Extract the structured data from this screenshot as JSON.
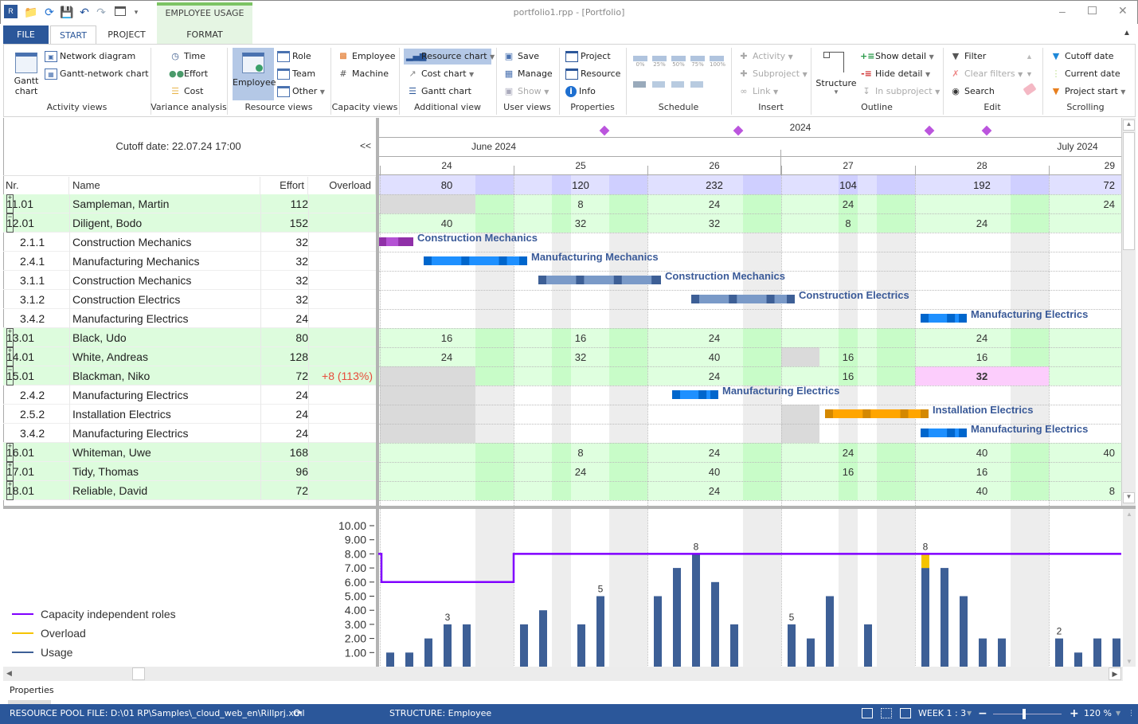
{
  "window": {
    "title": "portfolio1.rpp - [Portfolio]",
    "context_tab_group": "EMPLOYEE USAGE",
    "quick_access": [
      "app-logo-icon",
      "open-folder-icon",
      "refresh-icon",
      "save-icon",
      "undo-icon",
      "redo-icon",
      "window-layout-icon",
      "customize-dropdown-icon"
    ]
  },
  "tabs": [
    {
      "label": "FILE",
      "active": false
    },
    {
      "label": "START",
      "active": true
    },
    {
      "label": "PROJECT",
      "active": false
    },
    {
      "label": "FORMAT",
      "active": false
    }
  ],
  "ribbon": {
    "activity_views": {
      "label": "Activity views",
      "gantt": "Gantt\nchart",
      "gantt_l1": "Gantt",
      "gantt_l2": "chart",
      "network": "Network diagram",
      "gantt_network": "Gantt-network chart"
    },
    "variance": {
      "label": "Variance analysis",
      "time": "Time",
      "effort": "Effort",
      "cost": "Cost"
    },
    "resource_views": {
      "label": "Resource views",
      "employee": "Employee",
      "role": "Role",
      "team": "Team",
      "other": "Other"
    },
    "capacity_views": {
      "label": "Capacity views",
      "employee": "Employee",
      "machine": "Machine"
    },
    "additional_view": {
      "label": "Additional view",
      "resource_chart": "Resource chart",
      "cost_chart": "Cost chart",
      "gantt_chart": "Gantt chart"
    },
    "user_views": {
      "label": "User views",
      "save": "Save",
      "manage": "Manage",
      "show": "Show"
    },
    "properties": {
      "label": "Properties",
      "project": "Project",
      "resource": "Resource",
      "info": "Info"
    },
    "schedule": {
      "label": "Schedule",
      "progress": [
        "0%",
        "25%",
        "50%",
        "75%",
        "100%"
      ]
    },
    "insert": {
      "label": "Insert",
      "activity": "Activity",
      "subproject": "Subproject",
      "link": "Link"
    },
    "outline": {
      "label": "Outline",
      "structure": "Structure",
      "show_detail": "Show detail",
      "hide_detail": "Hide detail",
      "in_subproject": "In subproject"
    },
    "edit": {
      "label": "Edit",
      "filter": "Filter",
      "clear_filters": "Clear filters",
      "search": "Search"
    },
    "scrolling": {
      "label": "Scrolling",
      "cutoff": "Cutoff date",
      "current": "Current date",
      "project_start": "Project start"
    }
  },
  "table": {
    "cutoff_text": "Cutoff date: 22.07.24 17:00",
    "collapse_label": "<<",
    "columns": [
      "Nr.",
      "Name",
      "Effort",
      "Overload"
    ],
    "rows": [
      {
        "nr": "11.01",
        "name": "Sampleman, Martin",
        "effort": "112",
        "overload": "",
        "group": true,
        "expanded": false
      },
      {
        "nr": "12.01",
        "name": "Diligent, Bodo",
        "effort": "152",
        "overload": "",
        "group": true,
        "expanded": true
      },
      {
        "nr": "2.1.1",
        "name": "Construction Mechanics",
        "effort": "32",
        "overload": "",
        "group": false
      },
      {
        "nr": "2.4.1",
        "name": "Manufacturing Mechanics",
        "effort": "32",
        "overload": "",
        "group": false
      },
      {
        "nr": "3.1.1",
        "name": "Construction Mechanics",
        "effort": "32",
        "overload": "",
        "group": false
      },
      {
        "nr": "3.1.2",
        "name": "Construction Electrics",
        "effort": "32",
        "overload": "",
        "group": false
      },
      {
        "nr": "3.4.2",
        "name": "Manufacturing Electrics",
        "effort": "24",
        "overload": "",
        "group": false
      },
      {
        "nr": "13.01",
        "name": "Black, Udo",
        "effort": "80",
        "overload": "",
        "group": true,
        "expanded": false
      },
      {
        "nr": "14.01",
        "name": "White, Andreas",
        "effort": "128",
        "overload": "",
        "group": true,
        "expanded": false
      },
      {
        "nr": "15.01",
        "name": "Blackman, Niko",
        "effort": "72",
        "overload": "+8 (113%)",
        "group": true,
        "expanded": true
      },
      {
        "nr": "2.4.2",
        "name": "Manufacturing Electrics",
        "effort": "24",
        "overload": "",
        "group": false
      },
      {
        "nr": "2.5.2",
        "name": "Installation Electrics",
        "effort": "24",
        "overload": "",
        "group": false
      },
      {
        "nr": "3.4.2",
        "name": "Manufacturing Electrics",
        "effort": "24",
        "overload": "",
        "group": false
      },
      {
        "nr": "16.01",
        "name": "Whiteman, Uwe",
        "effort": "168",
        "overload": "",
        "group": true,
        "expanded": false
      },
      {
        "nr": "17.01",
        "name": "Tidy, Thomas",
        "effort": "96",
        "overload": "",
        "group": true,
        "expanded": false
      },
      {
        "nr": "18.01",
        "name": "Reliable, David",
        "effort": "72",
        "overload": "",
        "group": true,
        "expanded": false
      }
    ]
  },
  "timeline": {
    "year": "2024",
    "months": [
      {
        "label": "June 2024"
      },
      {
        "label": "July 2024"
      }
    ],
    "days": [
      "24",
      "25",
      "26",
      "27",
      "28",
      "29"
    ],
    "milestones_count": 4,
    "totals": [
      "80",
      "120",
      "232",
      "104",
      "192",
      "72"
    ],
    "group_values": {
      "11.01": [
        "",
        "8",
        "24",
        "24",
        "",
        "24"
      ],
      "12.01": [
        "40",
        "32",
        "32",
        "8",
        "24",
        ""
      ],
      "13.01": [
        "16",
        "16",
        "24",
        "",
        "24",
        ""
      ],
      "14.01": [
        "24",
        "32",
        "40",
        "16",
        "16",
        ""
      ],
      "15.01": [
        "",
        "",
        "24",
        "16",
        "32",
        ""
      ],
      "16.01": [
        "",
        "8",
        "24",
        "24",
        "40",
        "40"
      ],
      "17.01": [
        "",
        "24",
        "40",
        "16",
        "16",
        ""
      ],
      "18.01": [
        "",
        "",
        "24",
        "",
        "40",
        "8"
      ]
    },
    "overload_cell": {
      "row": "15.01",
      "day": "28",
      "value": "32",
      "color": "#fccdfc"
    },
    "task_bars": [
      {
        "row": 2,
        "label": "Construction Mechanics",
        "color": "#b452d4",
        "color_dark": "#9030a8"
      },
      {
        "row": 3,
        "label": "Manufacturing Mechanics",
        "color": "#1e90ff",
        "color_dark": "#0066cc"
      },
      {
        "row": 4,
        "label": "Construction Mechanics",
        "color": "#7a9ac8",
        "color_dark": "#3d5f96"
      },
      {
        "row": 5,
        "label": "Construction Electrics",
        "color": "#7a9ac8",
        "color_dark": "#3d5f96"
      },
      {
        "row": 6,
        "label": "Manufacturing Electrics",
        "color": "#1e90ff",
        "color_dark": "#0066cc"
      },
      {
        "row": 10,
        "label": "Manufacturing Electrics",
        "color": "#1e90ff",
        "color_dark": "#0066cc"
      },
      {
        "row": 11,
        "label": "Installation Electrics",
        "color": "#ffa500",
        "color_dark": "#d48800"
      },
      {
        "row": 12,
        "label": "Manufacturing Electrics",
        "color": "#1e90ff",
        "color_dark": "#0066cc"
      }
    ]
  },
  "chart_data": {
    "type": "bar",
    "title": "",
    "xlabel": "",
    "ylabel": "",
    "ylim": [
      0,
      10
    ],
    "yticks": [
      "1.00",
      "2.00",
      "3.00",
      "4.00",
      "5.00",
      "6.00",
      "7.00",
      "8.00",
      "9.00",
      "10.00"
    ],
    "x_days": [
      "24",
      "25",
      "26",
      "27",
      "28",
      "29"
    ],
    "slots_per_day": 7,
    "series": [
      {
        "name": "Usage",
        "color": "#3d5f96",
        "values": [
          1,
          1,
          2,
          3,
          3,
          null,
          null,
          3,
          4,
          null,
          3,
          5,
          null,
          null,
          5,
          7,
          8,
          6,
          3,
          null,
          null,
          3,
          2,
          5,
          null,
          3,
          null,
          null,
          7,
          7,
          5,
          2,
          2,
          null,
          null,
          2,
          1,
          2,
          2
        ]
      },
      {
        "name": "Overload",
        "color": "#f5c400",
        "values": [
          0,
          0,
          0,
          0,
          0,
          null,
          null,
          0,
          0,
          null,
          0,
          0,
          null,
          null,
          0,
          0,
          0,
          0,
          0,
          null,
          null,
          0,
          0,
          0,
          null,
          0,
          null,
          null,
          1,
          0,
          0,
          0,
          0,
          null,
          null,
          0,
          0,
          0,
          0
        ]
      },
      {
        "name": "Capacity independent roles",
        "color": "#8000ff",
        "type": "step",
        "values": [
          {
            "from_day": 0,
            "to_day": 1,
            "value": 6
          },
          {
            "from_day": 1,
            "to_day": 6,
            "value": 8
          }
        ]
      }
    ],
    "data_labels": [
      {
        "slot": 3,
        "text": "3"
      },
      {
        "slot": 11,
        "text": "5"
      },
      {
        "slot": 16,
        "text": "8"
      },
      {
        "slot": 21,
        "text": "5"
      },
      {
        "slot": 28,
        "text": "8"
      },
      {
        "slot": 35,
        "text": "2"
      }
    ],
    "legend": [
      "Capacity independent roles",
      "Overload",
      "Usage"
    ],
    "legend_position": "bottom-left"
  },
  "properties_label": "Properties",
  "status": {
    "pool_file": "RESOURCE POOL FILE: D:\\01 RP\\Samples\\_cloud_web_en\\Rillprj.xml",
    "structure": "STRUCTURE: Employee",
    "scale": "WEEK 1 : 3",
    "zoom": "120 %",
    "zoom_minus": "−",
    "zoom_plus": "+",
    "zoom_fraction": 0.45
  }
}
